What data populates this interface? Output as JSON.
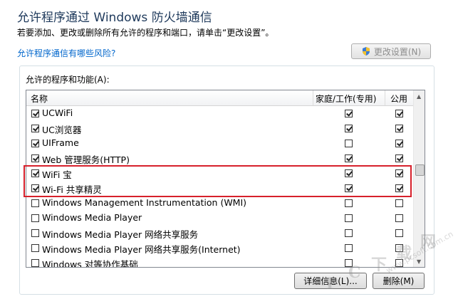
{
  "header": {
    "title": "允许程序通过 Windows 防火墙通信",
    "subtitle": "若要添加、更改或删除所有允许的程序和端口，请单击“更改设置”。"
  },
  "risk_link": "允许程序通信有哪些风险?",
  "change_settings_button": "更改设置(N)",
  "group_label": "允许的程序和功能(A):",
  "columns": {
    "name": "名称",
    "home": "家庭/工作(专用)",
    "public": "公用"
  },
  "programs": [
    {
      "name": "UCWiFi",
      "enabled": true,
      "home": true,
      "public": true
    },
    {
      "name": "UC浏览器",
      "enabled": true,
      "home": true,
      "public": true
    },
    {
      "name": "UIFrame",
      "enabled": true,
      "home": false,
      "public": true
    },
    {
      "name": "Web 管理服务(HTTP)",
      "enabled": true,
      "home": true,
      "public": true
    },
    {
      "name": "WiFi 宝",
      "enabled": true,
      "home": true,
      "public": true
    },
    {
      "name": "Wi-Fi 共享精灵",
      "enabled": true,
      "home": true,
      "public": true
    },
    {
      "name": "Windows Management Instrumentation (WMI)",
      "enabled": false,
      "home": false,
      "public": false
    },
    {
      "name": "Windows Media Player",
      "enabled": false,
      "home": false,
      "public": false
    },
    {
      "name": "Windows Media Player 网络共享服务",
      "enabled": false,
      "home": false,
      "public": false
    },
    {
      "name": "Windows Media Player 网络共享服务(Internet)",
      "enabled": false,
      "home": false,
      "public": false
    },
    {
      "name": "Windows 对等协作基础",
      "enabled": false,
      "home": false,
      "public": false
    }
  ],
  "details_button": "详细信息(L)...",
  "remove_button": "删除(M)",
  "watermark": {
    "letters": [
      "P",
      "C",
      "下",
      "载",
      "网"
    ],
    "url": "www.pcsoft.com.cn"
  },
  "colors": {
    "highlight": "#d7202b",
    "title": "#1e395b",
    "link": "#0066cc"
  }
}
